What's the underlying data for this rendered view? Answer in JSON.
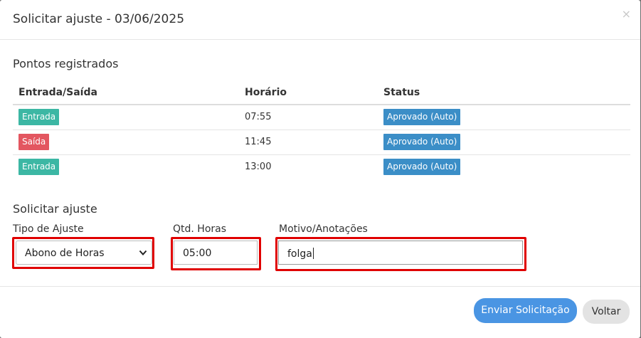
{
  "modal": {
    "title": "Solicitar ajuste - 03/06/2025",
    "close_symbol": "×"
  },
  "registered": {
    "title": "Pontos registrados",
    "columns": [
      "Entrada/Saída",
      "Horário",
      "Status"
    ],
    "rows": [
      {
        "type": "Entrada",
        "time": "07:55",
        "status": "Aprovado (Auto)"
      },
      {
        "type": "Saída",
        "time": "11:45",
        "status": "Aprovado (Auto)"
      },
      {
        "type": "Entrada",
        "time": "13:00",
        "status": "Aprovado (Auto)"
      }
    ]
  },
  "adjust": {
    "title": "Solicitar ajuste",
    "type_label": "Tipo de Ajuste",
    "type_value": "Abono de Horas",
    "hours_label": "Qtd. Horas",
    "hours_value": "05:00",
    "reason_label": "Motivo/Anotações",
    "reason_value": "folga"
  },
  "footer": {
    "submit_label": "Enviar Solicitação",
    "back_label": "Voltar"
  },
  "colors": {
    "entrada": "#3cb7a4",
    "saida": "#e35660",
    "status": "#3b8ec7",
    "primary": "#4a95e3",
    "highlight": "#e00000"
  },
  "icons": {
    "close": "close-icon",
    "select": "chevron-down-icon"
  }
}
